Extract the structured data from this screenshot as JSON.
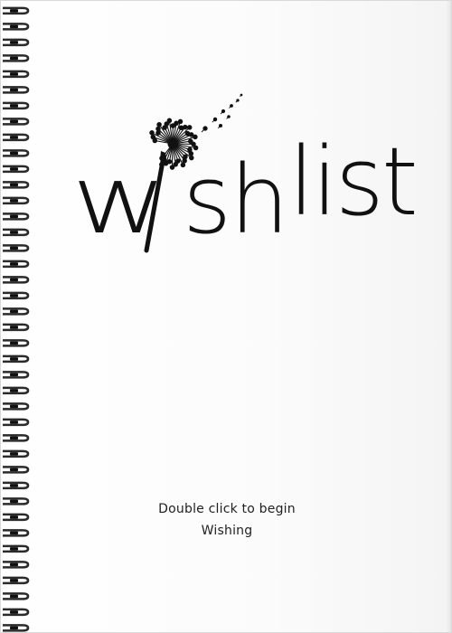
{
  "cover": {
    "title_first": "w",
    "title_middle": "sh",
    "title_second": "list",
    "instruction_line1": "Double click to begin",
    "instruction_line2": "Wishing"
  },
  "binding": {
    "ring_count": 40
  },
  "colors": {
    "page": "#ffffff",
    "ink": "#111111",
    "binding_metal": "#2b2b2b",
    "caption": "#1f1f1f"
  },
  "icons": {
    "title_letter_i": "dandelion-icon",
    "seeds": "dandelion-seed-icon"
  }
}
